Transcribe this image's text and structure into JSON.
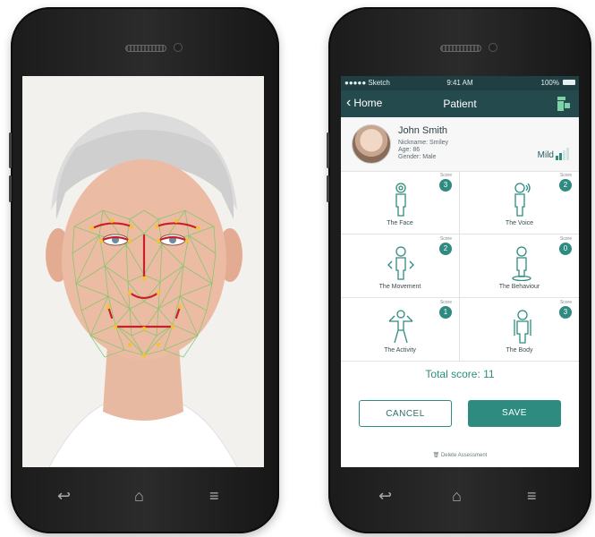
{
  "status_bar": {
    "carrier": "●●●●● Sketch",
    "time": "9:41 AM",
    "battery": "100%"
  },
  "app_bar": {
    "back_label": "Home",
    "title": "Patient"
  },
  "patient": {
    "name": "John Smith",
    "nickname": "Nickname: Smiley",
    "age": "Age: 86",
    "gender": "Gender: Male",
    "severity": "Mild"
  },
  "assessment": {
    "score_label": "Score",
    "cells": [
      {
        "label": "The Face",
        "score": "3",
        "icon": "face-person-icon"
      },
      {
        "label": "The Voice",
        "score": "2",
        "icon": "voice-person-icon"
      },
      {
        "label": "The Movement",
        "score": "2",
        "icon": "movement-person-icon"
      },
      {
        "label": "The Behaviour",
        "score": "0",
        "icon": "behaviour-person-icon"
      },
      {
        "label": "The Activity",
        "score": "1",
        "icon": "activity-person-icon"
      },
      {
        "label": "The Body",
        "score": "3",
        "icon": "body-person-icon"
      }
    ],
    "total": "Total score: 11"
  },
  "actions": {
    "cancel": "CANCEL",
    "save": "SAVE",
    "delete": "Delete Assessment"
  },
  "colors": {
    "accent": "#2e8b80",
    "header": "#244a4e",
    "status": "#1f3f43",
    "mesh": "#7fc66a",
    "mesh_marker": "#c8202a"
  }
}
